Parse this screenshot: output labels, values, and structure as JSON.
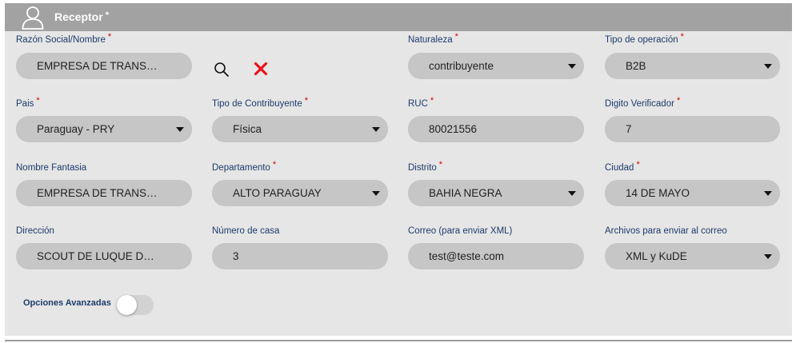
{
  "header": {
    "title": "Receptor",
    "required_mark": "*"
  },
  "fields": {
    "razon_social": {
      "label": "Razón Social/Nombre",
      "required": "*",
      "value": "EMPRESA DE TRANSPO..."
    },
    "naturaleza": {
      "label": "Naturaleza",
      "required": "*",
      "value": "contribuyente"
    },
    "tipo_operacion": {
      "label": "Tipo de operación",
      "required": "*",
      "value": "B2B"
    },
    "pais": {
      "label": "Pais",
      "required": "*",
      "value": "Paraguay - PRY"
    },
    "tipo_contribuyente": {
      "label": "Tipo de Contribuyente",
      "required": "*",
      "value": "Física"
    },
    "ruc": {
      "label": "RUC",
      "required": "*",
      "value": "80021556"
    },
    "digito_verificador": {
      "label": "Digito Verificador",
      "required": "*",
      "value": "7"
    },
    "nombre_fantasia": {
      "label": "Nombre Fantasia",
      "value": "EMPRESA DE TRANSPO..."
    },
    "departamento": {
      "label": "Departamento",
      "required": "*",
      "value": "ALTO PARAGUAY"
    },
    "distrito": {
      "label": "Distrito",
      "required": "*",
      "value": "BAHIA NEGRA"
    },
    "ciudad": {
      "label": "Ciudad",
      "required": "*",
      "value": "14 DE MAYO"
    },
    "direccion": {
      "label": "Dirección",
      "value": "SCOUT DE LUQUE DE LA..."
    },
    "numero_casa": {
      "label": "Número de casa",
      "value": "3"
    },
    "correo": {
      "label": "Correo (para enviar XML)",
      "value": "test@teste.com"
    },
    "archivos": {
      "label": "Archivos para enviar al correo",
      "value": "XML y KuDE"
    }
  },
  "advanced": {
    "label": "Opciones Avanzadas",
    "enabled": false
  },
  "icons": {
    "user": "user-icon",
    "search": "search-icon",
    "clear": "clear-x-icon",
    "dropdown": "caret-down-icon"
  },
  "colors": {
    "header_bg": "#a2a2a2",
    "panel_bg": "#e6e6e6",
    "field_bg": "#c6c6c6",
    "label": "#1d3a6b",
    "required": "#d40000",
    "clear_icon": "#e8141c"
  }
}
